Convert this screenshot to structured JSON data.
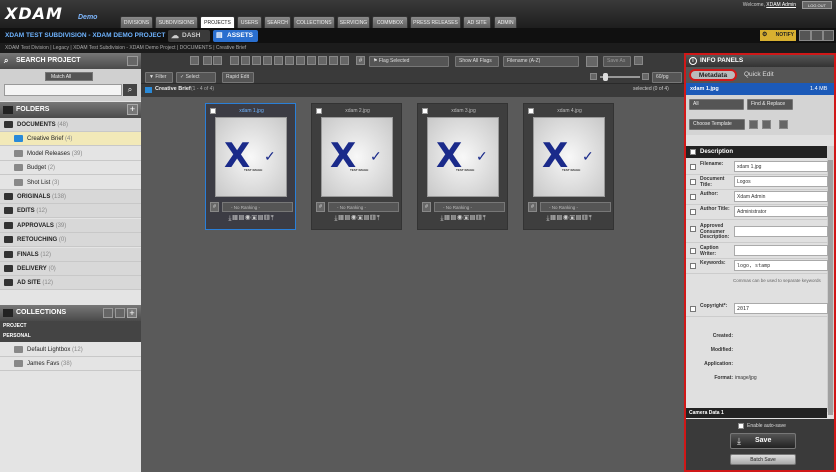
{
  "app": {
    "logo": "XDAM",
    "logo_sub": "Demo",
    "welcome_prefix": "Welcome,",
    "user": "XDAM Admin",
    "logout": "LOG OUT"
  },
  "nav": {
    "tabs": [
      "DIVISIONS",
      "SUBDIVISIONS",
      "PROJECTS",
      "USERS",
      "SEARCH",
      "COLLECTIONS",
      "SERVICING",
      "COMMBOX",
      "PRESS RELEASES",
      "AD SITE",
      "ADMIN"
    ],
    "active": "PROJECTS"
  },
  "project": {
    "title": "XDAM TEST SUBDIVISION - XDAM DEMO PROJECT",
    "dash": "DASH",
    "assets": "ASSETS",
    "notify": "NOTIFY"
  },
  "breadcrumb": "XDAM Test Division | Legacy | XDAM Test Subdivision - XDAM Demo Project | DOCUMENTS | Creative Brief",
  "left": {
    "search_title": "SEARCH PROJECT",
    "match": "Match All",
    "folders_title": "FOLDERS",
    "folders": [
      {
        "name": "DOCUMENTS",
        "count": "(48)",
        "level": 0
      },
      {
        "name": "Creative Brief",
        "count": "(4)",
        "level": 1,
        "selected": true
      },
      {
        "name": "Model Releases",
        "count": "(39)",
        "level": 1
      },
      {
        "name": "Budget",
        "count": "(2)",
        "level": 1
      },
      {
        "name": "Shot List",
        "count": "(3)",
        "level": 1
      },
      {
        "name": "ORIGINALS",
        "count": "(138)",
        "level": 0
      },
      {
        "name": "EDITS",
        "count": "(12)",
        "level": 0
      },
      {
        "name": "APPROVALS",
        "count": "(39)",
        "level": 0
      },
      {
        "name": "RETOUCHING",
        "count": "(0)",
        "level": 0
      },
      {
        "name": "FINALS",
        "count": "(12)",
        "level": 0
      },
      {
        "name": "DELIVERY",
        "count": "(0)",
        "level": 0
      },
      {
        "name": "AD SITE",
        "count": "(12)",
        "level": 0
      }
    ],
    "collections_title": "COLLECTIONS",
    "coll_project": "PROJECT",
    "coll_personal": "PERSONAL",
    "collections": [
      {
        "name": "Default Lightbox",
        "count": "(12)"
      },
      {
        "name": "James Favs",
        "count": "(38)"
      }
    ]
  },
  "toolbar": {
    "flag": "Flag Selected",
    "show_flags": "Show All Flags",
    "sort": "Filename (A-Z)",
    "save_as": "Save As",
    "filter": "Filter",
    "select": "Select",
    "rapid": "Rapid Edit",
    "size": "60/pg"
  },
  "pathbar": {
    "folder": "Creative Brief",
    "range": "(1 - 4 of 4)",
    "selected": "selected (0 of 4)"
  },
  "assets": [
    {
      "name": "xdam 1.jpg",
      "rank": "- No Ranking -",
      "selected": true
    },
    {
      "name": "xdam 2.jpg",
      "rank": "- No Ranking -",
      "selected": false
    },
    {
      "name": "xdam 3.jpg",
      "rank": "- No Ranking -",
      "selected": false
    },
    {
      "name": "xdam 4.jpg",
      "rank": "- No Ranking -",
      "selected": false
    }
  ],
  "thumb_label": "TEST IMAGE",
  "info": {
    "title": "INFO PANELS",
    "tab_metadata": "Metadata",
    "tab_quick": "Quick Edit",
    "file": "xdam 1.jpg",
    "size": "1.4 MB",
    "filter_all": "All",
    "find_replace": "Find & Replace",
    "template": "Choose Template",
    "description": "Description",
    "fields": [
      {
        "label": "Filename:",
        "value": "xdam 1.jpg"
      },
      {
        "label": "Document Title:",
        "value": "Logos"
      },
      {
        "label": "Author:",
        "value": "Xdam Admin"
      },
      {
        "label": "Author Title:",
        "value": "Administrator"
      },
      {
        "label": "Approved Consumer Description:",
        "value": ""
      },
      {
        "label": "Caption Writer:",
        "value": ""
      },
      {
        "label": "Keywords:",
        "value": "logo, stamp"
      },
      {
        "label": "Copyright*:",
        "value": "2017"
      }
    ],
    "keywords_hint": "Commas can be used to separate keywords",
    "readonly": [
      {
        "label": "Created:",
        "value": ""
      },
      {
        "label": "Modified:",
        "value": ""
      },
      {
        "label": "Application:",
        "value": ""
      },
      {
        "label": "Format:",
        "value": "image/jpg"
      }
    ],
    "camera": "Camera Data 1",
    "autosave": "Enable auto-save",
    "save": "Save",
    "batch": "Batch Save"
  }
}
